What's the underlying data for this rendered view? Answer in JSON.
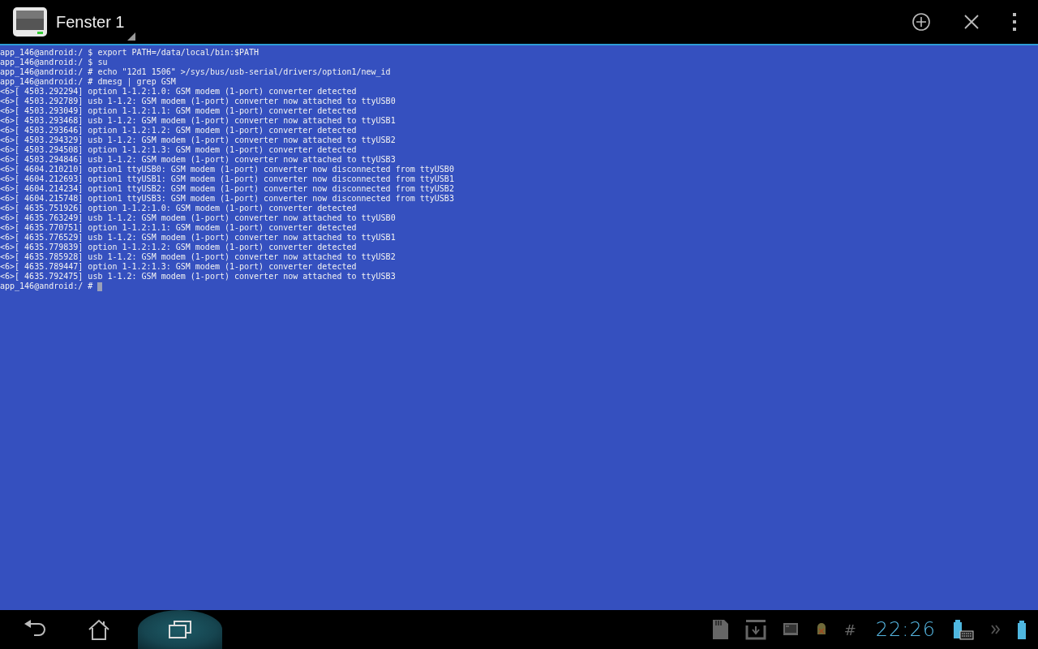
{
  "action_bar": {
    "title": "Fenster 1"
  },
  "terminal": {
    "cursor": true,
    "lines": [
      "app_146@android:/ $ export PATH=/data/local/bin:$PATH",
      "app_146@android:/ $ su",
      "app_146@android:/ # echo \"12d1 1506\" >/sys/bus/usb-serial/drivers/option1/new_id",
      "app_146@android:/ # dmesg | grep GSM",
      "<6>[ 4503.292294] option 1-1.2:1.0: GSM modem (1-port) converter detected",
      "<6>[ 4503.292789] usb 1-1.2: GSM modem (1-port) converter now attached to ttyUSB0",
      "<6>[ 4503.293049] option 1-1.2:1.1: GSM modem (1-port) converter detected",
      "<6>[ 4503.293468] usb 1-1.2: GSM modem (1-port) converter now attached to ttyUSB1",
      "<6>[ 4503.293646] option 1-1.2:1.2: GSM modem (1-port) converter detected",
      "<6>[ 4503.294329] usb 1-1.2: GSM modem (1-port) converter now attached to ttyUSB2",
      "<6>[ 4503.294508] option 1-1.2:1.3: GSM modem (1-port) converter detected",
      "<6>[ 4503.294846] usb 1-1.2: GSM modem (1-port) converter now attached to ttyUSB3",
      "<6>[ 4604.210210] option1 ttyUSB0: GSM modem (1-port) converter now disconnected from ttyUSB0",
      "<6>[ 4604.212693] option1 ttyUSB1: GSM modem (1-port) converter now disconnected from ttyUSB1",
      "<6>[ 4604.214234] option1 ttyUSB2: GSM modem (1-port) converter now disconnected from ttyUSB2",
      "<6>[ 4604.215748] option1 ttyUSB3: GSM modem (1-port) converter now disconnected from ttyUSB3",
      "<6>[ 4635.751926] option 1-1.2:1.0: GSM modem (1-port) converter detected",
      "<6>[ 4635.763249] usb 1-1.2: GSM modem (1-port) converter now attached to ttyUSB0",
      "<6>[ 4635.770751] option 1-1.2:1.1: GSM modem (1-port) converter detected",
      "<6>[ 4635.776529] usb 1-1.2: GSM modem (1-port) converter now attached to ttyUSB1",
      "<6>[ 4635.779839] option 1-1.2:1.2: GSM modem (1-port) converter detected",
      "<6>[ 4635.785928] usb 1-1.2: GSM modem (1-port) converter now attached to ttyUSB2",
      "<6>[ 4635.789447] option 1-1.2:1.3: GSM modem (1-port) converter detected",
      "<6>[ 4635.792475] usb 1-1.2: GSM modem (1-port) converter now attached to ttyUSB3",
      "app_146@android:/ #"
    ]
  },
  "navigation": [
    {
      "kind": "back",
      "selected": false
    },
    {
      "kind": "home",
      "selected": false
    },
    {
      "kind": "recents",
      "selected": true
    }
  ],
  "status": {
    "symbol": "#",
    "time": "22:26"
  }
}
